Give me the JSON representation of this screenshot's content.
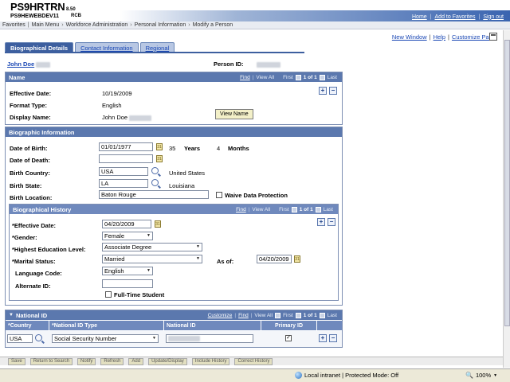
{
  "banner": {
    "brand": "PS9HRTRN",
    "version": "8.50",
    "database": "PS9HEWEBDEV11",
    "node": "RCB",
    "links": [
      "Home",
      "Add to Favorites",
      "Sign out"
    ]
  },
  "breadcrumbs": [
    "Favorites",
    "Main Menu",
    "Workforce Administration",
    "Personal Information",
    "Modify a Person"
  ],
  "utility_links": [
    "New Window",
    "Help",
    "Customize Page"
  ],
  "tabs": [
    {
      "label": "Biographical Details",
      "active": true
    },
    {
      "label": "Contact Information",
      "active": false
    },
    {
      "label": "Regional",
      "active": false
    }
  ],
  "person": {
    "name": "John Doe",
    "id_label": "Person ID:"
  },
  "name_section": {
    "title": "Name",
    "nav": {
      "find": "Find",
      "view_all": "View All",
      "first": "First",
      "count": "1 of 1",
      "last": "Last"
    },
    "effective_date_label": "Effective Date:",
    "effective_date": "10/19/2009",
    "format_type_label": "Format Type:",
    "format_type": "English",
    "display_name_label": "Display Name:",
    "display_name": "John Doe",
    "view_name_button": "View Name"
  },
  "bio_info": {
    "title": "Biographic Information",
    "dob_label": "Date of Birth:",
    "dob": "01/01/1977",
    "age_years": "35",
    "years_label": "Years",
    "age_months": "4",
    "months_label": "Months",
    "dod_label": "Date of Death:",
    "dod": "",
    "birth_country_label": "Birth Country:",
    "birth_country": "USA",
    "birth_country_desc": "United States",
    "birth_state_label": "Birth State:",
    "birth_state": "LA",
    "birth_state_desc": "Louisiana",
    "birth_location_label": "Birth Location:",
    "birth_location": "Baton Rouge",
    "waive_label": "Waive Data Protection"
  },
  "bio_history": {
    "title": "Biographical History",
    "nav": {
      "find": "Find",
      "view_all": "View All",
      "first": "First",
      "count": "1 of 1",
      "last": "Last"
    },
    "effective_date_label": "*Effective Date:",
    "effective_date": "04/20/2009",
    "gender_label": "*Gender:",
    "gender": "Female",
    "education_label": "*Highest Education Level:",
    "education": "Associate Degree",
    "marital_label": "*Marital Status:",
    "marital": "Married",
    "as_of_label": "As of:",
    "as_of": "04/20/2009",
    "language_label": "Language Code:",
    "language": "English",
    "alt_id_label": "Alternate ID:",
    "alt_id": "",
    "fulltime_label": "Full-Time Student"
  },
  "national_id": {
    "title": "National ID",
    "nav": {
      "customize": "Customize",
      "find": "Find",
      "view_all": "View All",
      "first": "First",
      "count": "1 of 1",
      "last": "Last"
    },
    "columns": [
      "*Country",
      "*National ID Type",
      "National ID",
      "Primary ID"
    ],
    "row": {
      "country": "USA",
      "type": "Social Security Number",
      "national_id": "",
      "primary": "✓"
    }
  },
  "toolbar": [
    "Save",
    "Return to Search",
    "Notify",
    "Refresh",
    "Add",
    "Update/Display",
    "Include History",
    "Correct History"
  ],
  "status": {
    "zone": "Local intranet | Protected Mode: Off",
    "zoom": "100%"
  },
  "icons": {
    "search": "magnifier-icon",
    "calendar": "calendar-icon",
    "add": "plus-icon",
    "delete": "minus-icon"
  }
}
